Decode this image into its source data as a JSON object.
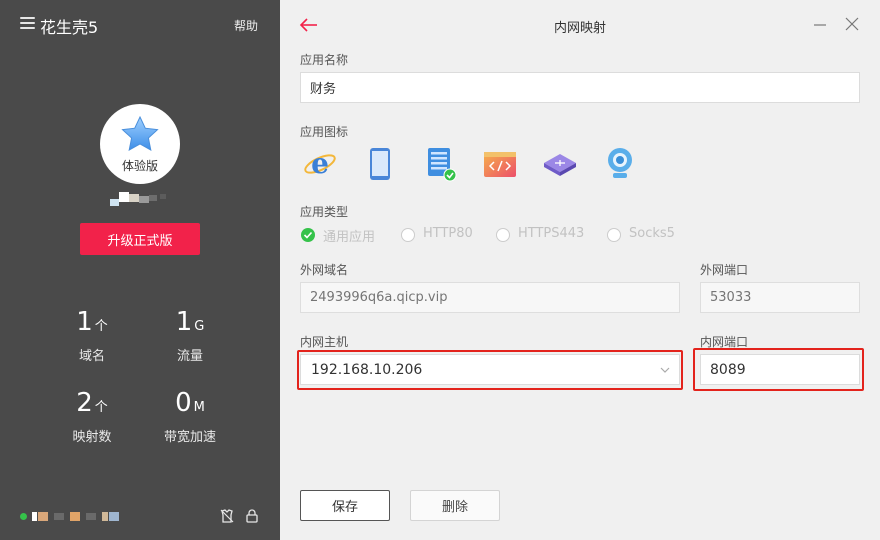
{
  "sidebar": {
    "app_title": "花生壳5",
    "help": "帮助",
    "avatar_label": "体验版",
    "upgrade_button": "升级正式版",
    "stats": [
      {
        "value": "1",
        "unit": "个",
        "label": "域名"
      },
      {
        "value": "1",
        "unit": "G",
        "label": "流量"
      },
      {
        "value": "2",
        "unit": "个",
        "label": "映射数"
      },
      {
        "value": "0",
        "unit": "M",
        "label": "带宽加速"
      }
    ],
    "status_color": "#35c24a"
  },
  "main": {
    "title": "内网映射",
    "app_name": {
      "label": "应用名称",
      "value": "财务"
    },
    "app_icon": {
      "label": "应用图标",
      "icons": [
        "ie-browser-icon",
        "mobile-phone-icon",
        "server-list-icon",
        "code-window-icon",
        "router-icon",
        "webcam-icon"
      ],
      "selected": "server-list-icon"
    },
    "app_type": {
      "label": "应用类型",
      "options": [
        "通用应用",
        "HTTP80",
        "HTTPS443",
        "Socks5"
      ],
      "selected": "通用应用"
    },
    "external_domain": {
      "label": "外网域名",
      "placeholder": "2493996q6a.qicp.vip"
    },
    "external_port": {
      "label": "外网端口",
      "placeholder": "53033"
    },
    "internal_host": {
      "label": "内网主机",
      "value": "192.168.10.206"
    },
    "internal_port": {
      "label": "内网端口",
      "value": "8089"
    },
    "save_button": "保存",
    "delete_button": "删除",
    "accent_color": "#f2224a",
    "highlight_color": "#e3231c"
  }
}
